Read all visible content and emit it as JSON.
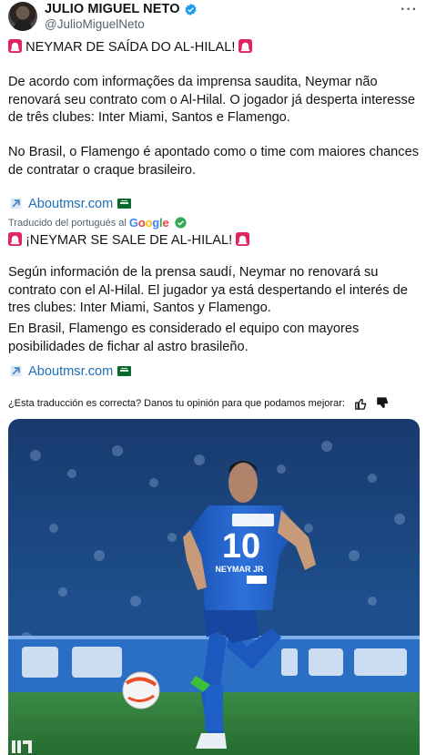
{
  "tweet": {
    "display_name": "JULIO MIGUEL NETO",
    "handle": "@JulioMiguelNeto",
    "more_icon": "more-horizontal-icon"
  },
  "original": {
    "headline": "NEYMAR DE SAÍDA DO AL-HILAL!",
    "paragraph1": "De acordo com informações da imprensa saudita, Neymar não renovará seu contrato com o Al-Hilal. O jogador já desperta interesse de três clubes: Inter Miami, Santos e Flamengo.",
    "paragraph2": "No Brasil, o Flamengo é apontado como o time com maiores chances de contratar o craque brasileiro.",
    "link": "Aboutmsr.com"
  },
  "translation": {
    "label": "Traducido del portugués al",
    "provider": "Google",
    "headline": "¡NEYMAR SE SALE DE AL-HILAL!",
    "paragraph1": "Según información de la prensa saudí, Neymar no renovará su contrato con el Al-Hilal. El jugador ya está despertando el interés de tres clubes: Inter Miami, Santos y Flamengo.",
    "paragraph2": "En Brasil, Flamengo es considerado el equipo con mayores posibilidades de fichar al astro brasileño.",
    "link": "Aboutmsr.com"
  },
  "feedback": {
    "question": "¿Esta traducción es correcta? Danos tu opinión para que podamos mejorar:"
  },
  "photo": {
    "jersey_number": "10",
    "jersey_name": "NEYMAR JR"
  },
  "colors": {
    "link": "#1d6fb8",
    "verified": "#1d9bf0",
    "pitch": "#2f7a3a",
    "kit": "#1e5fc8"
  }
}
